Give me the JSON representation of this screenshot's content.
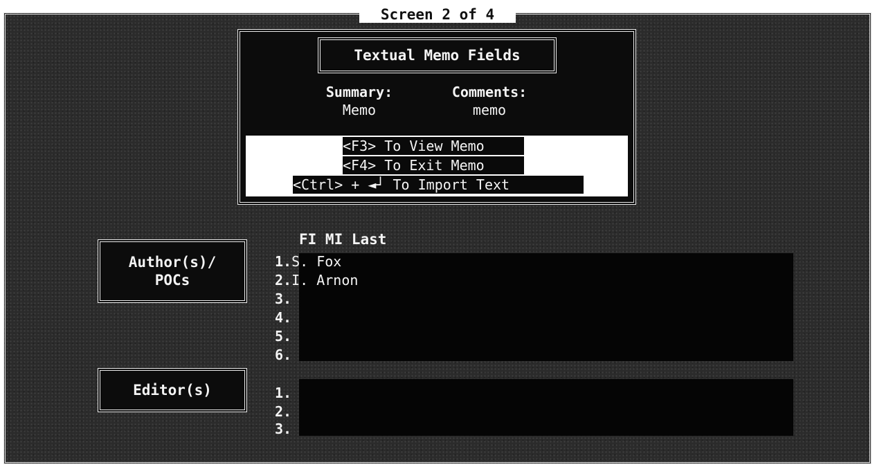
{
  "screen_title": "Screen 2 of 4",
  "memo_panel": {
    "title": "Textual Memo Fields",
    "summary_label": "Summary:",
    "summary_value": "Memo",
    "comments_label": "Comments:",
    "comments_value": "memo",
    "key_f3": "<F3> To View Memo",
    "key_f4": "<F4> To Exit Memo",
    "key_ctrl": "<Ctrl> + ◄┘ To Import Text"
  },
  "authors": {
    "button_label": "Author(s)/\nPOCs",
    "header": "FI MI Last",
    "rows": [
      {
        "num": "1.",
        "name": "S. Fox"
      },
      {
        "num": "2.",
        "name": "I. Arnon"
      },
      {
        "num": "3.",
        "name": ""
      },
      {
        "num": "4.",
        "name": ""
      },
      {
        "num": "5.",
        "name": ""
      },
      {
        "num": "6.",
        "name": ""
      }
    ]
  },
  "editors": {
    "button_label": "Editor(s)",
    "rows": [
      {
        "num": "1.",
        "name": ""
      },
      {
        "num": "2.",
        "name": ""
      },
      {
        "num": "3.",
        "name": ""
      }
    ]
  }
}
